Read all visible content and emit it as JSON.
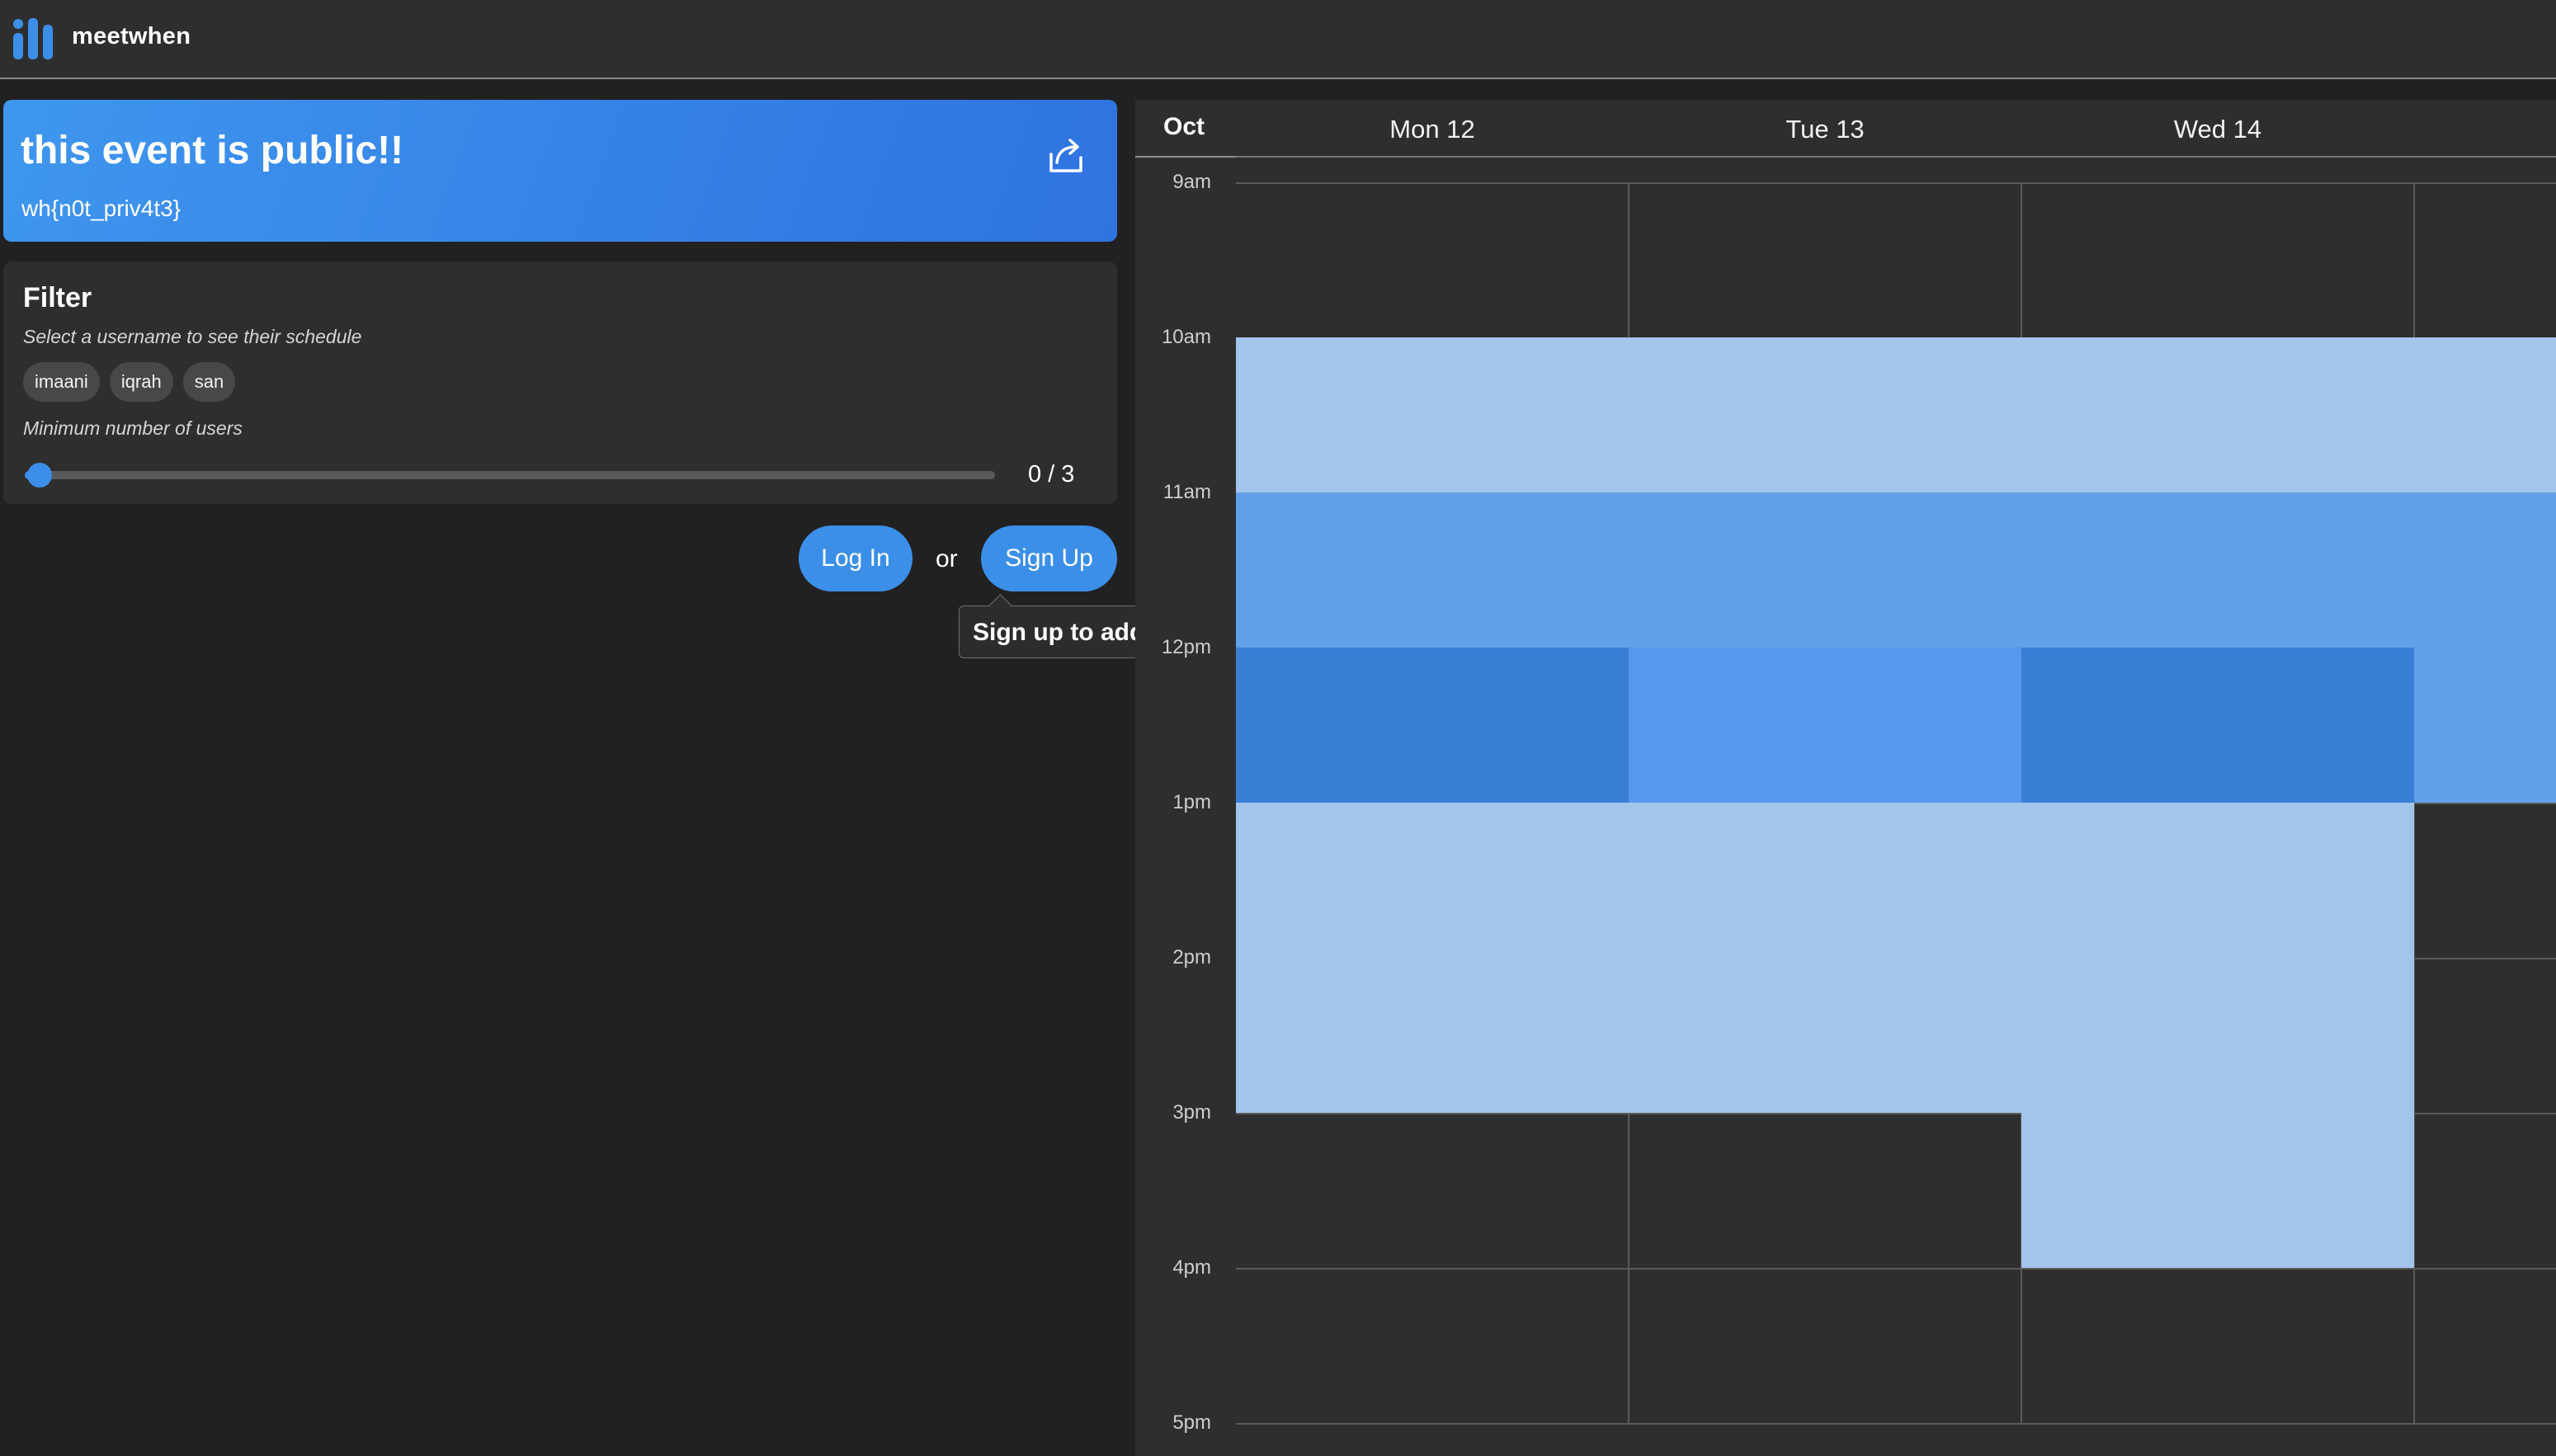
{
  "app": {
    "name": "meetwhen"
  },
  "event": {
    "title": "this event is public!!",
    "description": "wh{n0t_priv4t3}"
  },
  "filter": {
    "title": "Filter",
    "hint": "Select a username to see their schedule",
    "users": [
      "imaani",
      "iqrah",
      "san"
    ],
    "min_users_label": "Minimum number of users",
    "min_users_value": 0,
    "min_users_max": 3,
    "value_text": "0 / 3"
  },
  "auth": {
    "login_label": "Log In",
    "or_label": "or",
    "signup_label": "Sign Up",
    "tooltip_text": "Sign up to add your schedule!",
    "tooltip_close": "×"
  },
  "calendar": {
    "month": "Oct",
    "days": [
      "Mon 12",
      "Tue 13",
      "Wed 14"
    ],
    "hours": [
      "9am",
      "10am",
      "11am",
      "12pm",
      "1pm",
      "2pm",
      "3pm",
      "4pm",
      "5pm"
    ],
    "colors": {
      "light": "#a3c5eb",
      "medium": "#61a1ea",
      "strong": "#5698ec",
      "dark": "#3a7fd6"
    },
    "availability": [
      {
        "day": 0,
        "start": 10,
        "end": 11,
        "shade": "light"
      },
      {
        "day": 0,
        "start": 11,
        "end": 12,
        "shade": "medium"
      },
      {
        "day": 0,
        "start": 12,
        "end": 13,
        "shade": "dark"
      },
      {
        "day": 0,
        "start": 13,
        "end": 15,
        "shade": "light"
      },
      {
        "day": 1,
        "start": 10,
        "end": 11,
        "shade": "light"
      },
      {
        "day": 1,
        "start": 11,
        "end": 12,
        "shade": "medium"
      },
      {
        "day": 1,
        "start": 12,
        "end": 13,
        "shade": "strong"
      },
      {
        "day": 1,
        "start": 13,
        "end": 15,
        "shade": "light"
      },
      {
        "day": 2,
        "start": 10,
        "end": 11,
        "shade": "light"
      },
      {
        "day": 2,
        "start": 11,
        "end": 12,
        "shade": "medium"
      },
      {
        "day": 2,
        "start": 12,
        "end": 13,
        "shade": "dark"
      },
      {
        "day": 2,
        "start": 13,
        "end": 16,
        "shade": "light"
      },
      {
        "day": 3,
        "start": 10,
        "end": 11,
        "shade": "light"
      },
      {
        "day": 3,
        "start": 11,
        "end": 13,
        "shade": "medium"
      }
    ]
  }
}
